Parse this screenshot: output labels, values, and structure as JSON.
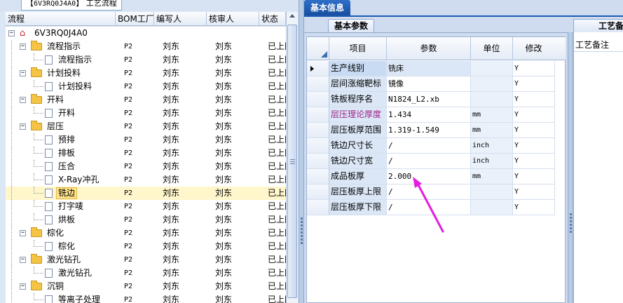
{
  "left_panel": {
    "tab_code": "6V3RQ0J4A0",
    "tab_title": "工艺流程",
    "headers": [
      "流程",
      "BOM工厂",
      "编写人",
      "核审人",
      "状态"
    ],
    "rows": [
      {
        "label": "6V3RQ0J4A0",
        "type": "root",
        "bom": "",
        "writer": "",
        "reviewer": "",
        "status": ""
      },
      {
        "label": "流程指示",
        "type": "folder",
        "bom": "P2",
        "writer": "刘东",
        "reviewer": "刘东",
        "status": "已上冈"
      },
      {
        "label": "流程指示",
        "type": "doc",
        "bom": "P2",
        "writer": "刘东",
        "reviewer": "刘东",
        "status": "已上冈"
      },
      {
        "label": "计划投料",
        "type": "folder",
        "bom": "P2",
        "writer": "刘东",
        "reviewer": "刘东",
        "status": "已上冈"
      },
      {
        "label": "计划投料",
        "type": "doc",
        "bom": "P2",
        "writer": "刘东",
        "reviewer": "刘东",
        "status": "已上冈"
      },
      {
        "label": "开料",
        "type": "folder",
        "bom": "P2",
        "writer": "刘东",
        "reviewer": "刘东",
        "status": "已上冈"
      },
      {
        "label": "开料",
        "type": "doc",
        "bom": "P2",
        "writer": "刘东",
        "reviewer": "刘东",
        "status": "已上冈"
      },
      {
        "label": "层压",
        "type": "folder",
        "bom": "P2",
        "writer": "刘东",
        "reviewer": "刘东",
        "status": "已上冈"
      },
      {
        "label": "预排",
        "type": "doc",
        "bom": "P2",
        "writer": "刘东",
        "reviewer": "刘东",
        "status": "已上冈"
      },
      {
        "label": "排板",
        "type": "doc",
        "bom": "P2",
        "writer": "刘东",
        "reviewer": "刘东",
        "status": "已上冈"
      },
      {
        "label": "压合",
        "type": "doc",
        "bom": "P2",
        "writer": "刘东",
        "reviewer": "刘东",
        "status": "已上冈"
      },
      {
        "label": "X-Ray冲孔",
        "type": "doc",
        "bom": "P2",
        "writer": "刘东",
        "reviewer": "刘东",
        "status": "已上冈"
      },
      {
        "label": "铣边",
        "type": "doc",
        "bom": "P2",
        "writer": "刘东",
        "reviewer": "刘东",
        "status": "已上冈",
        "selected": true
      },
      {
        "label": "打字唛",
        "type": "doc",
        "bom": "P2",
        "writer": "刘东",
        "reviewer": "刘东",
        "status": "已上冈"
      },
      {
        "label": "烘板",
        "type": "doc",
        "bom": "P2",
        "writer": "刘东",
        "reviewer": "刘东",
        "status": "已上冈"
      },
      {
        "label": "棕化",
        "type": "folder",
        "bom": "P2",
        "writer": "刘东",
        "reviewer": "刘东",
        "status": "已上冈"
      },
      {
        "label": "棕化",
        "type": "doc",
        "bom": "P2",
        "writer": "刘东",
        "reviewer": "刘东",
        "status": "已上冈"
      },
      {
        "label": "激光钻孔",
        "type": "folder",
        "bom": "P2",
        "writer": "刘东",
        "reviewer": "刘东",
        "status": "已上冈"
      },
      {
        "label": "激光钻孔",
        "type": "doc",
        "bom": "P2",
        "writer": "刘东",
        "reviewer": "刘东",
        "status": "已上冈"
      },
      {
        "label": "沉铜",
        "type": "folder",
        "bom": "P2",
        "writer": "刘东",
        "reviewer": "刘东",
        "status": "已上冈"
      },
      {
        "label": "等离子处理",
        "type": "doc",
        "bom": "P2",
        "writer": "刘东",
        "reviewer": "刘东",
        "status": "已上冈"
      }
    ]
  },
  "right_panel": {
    "main_tab": "基本信息",
    "sub_tab": "基本参数",
    "side_tab": "工艺备注",
    "side_label": "工艺备注",
    "grid_headers": [
      "项目",
      "参数",
      "单位",
      "修改"
    ],
    "grid_rows": [
      {
        "item": "生产线别",
        "value": "铣床",
        "unit": "",
        "mod": "Y",
        "current": true
      },
      {
        "item": "层间涨缩靶标",
        "value": "镜像",
        "unit": "",
        "mod": "Y"
      },
      {
        "item": "铣板程序名",
        "value": "N1824_L2.xb",
        "unit": "",
        "mod": "Y"
      },
      {
        "item": "层压理论厚度",
        "value": "1.434",
        "unit": "mm",
        "mod": "Y",
        "highlight_color": "#a0208a"
      },
      {
        "item": "层压板厚范围",
        "value": "1.319-1.549",
        "unit": "mm",
        "mod": "Y"
      },
      {
        "item": "铣边尺寸长",
        "value": "/",
        "unit": "inch",
        "mod": "Y"
      },
      {
        "item": "铣边尺寸宽",
        "value": "/",
        "unit": "inch",
        "mod": "Y"
      },
      {
        "item": "成品板厚",
        "value": "2.000",
        "unit": "mm",
        "mod": "Y"
      },
      {
        "item": "层压板厚上限",
        "value": "/",
        "unit": "",
        "mod": "Y"
      },
      {
        "item": "层压板厚下限",
        "value": "/",
        "unit": "",
        "mod": "Y"
      }
    ]
  },
  "colors": {
    "accent_tab": "#1f5cb5",
    "selection": "#fde38a",
    "annotation_arrow": "#e51ee0"
  }
}
